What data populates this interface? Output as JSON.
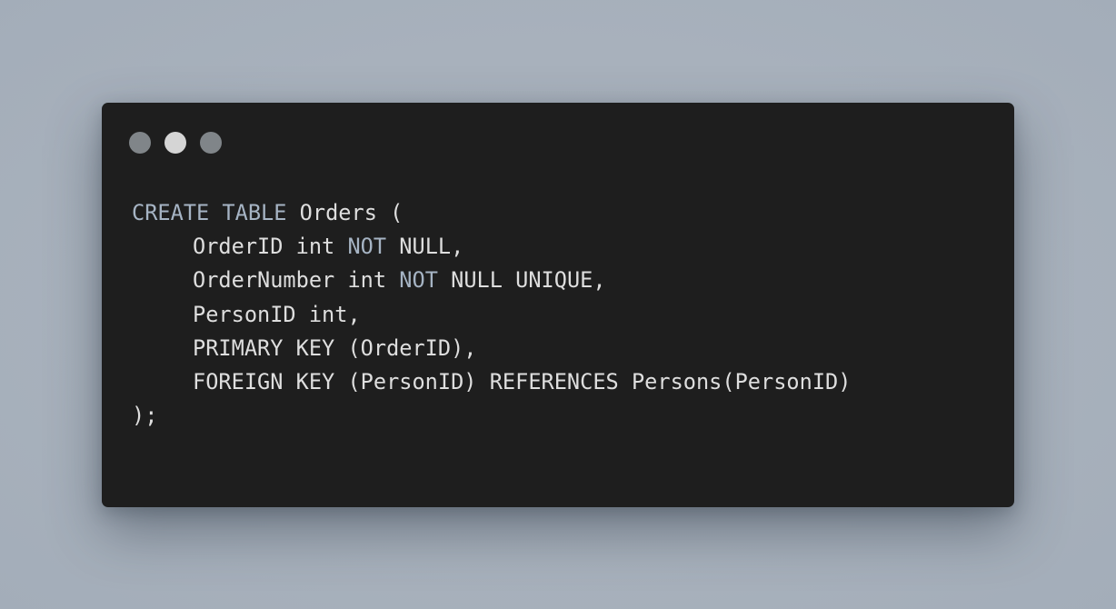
{
  "window": {
    "controls": [
      {
        "name": "close-dot",
        "color": "#808589"
      },
      {
        "name": "minimize-dot",
        "color": "#d5d5d5"
      },
      {
        "name": "maximize-dot",
        "color": "#808589"
      }
    ],
    "colors": {
      "background": "#1e1e1e",
      "text": "#dedede",
      "keyword": "#a6b4c4"
    }
  },
  "code": {
    "lines": [
      {
        "kw": "CREATE TABLE",
        "text": " Orders ("
      },
      {
        "text": "OrderID int ",
        "kw": "NOT",
        "tail": " NULL,"
      },
      {
        "text": "OrderNumber int ",
        "kw": "NOT",
        "tail": " NULL UNIQUE,"
      },
      {
        "text": "PersonID int,"
      },
      {
        "text": "PRIMARY KEY (OrderID),"
      },
      {
        "text": "FOREIGN KEY (PersonID) REFERENCES Persons(PersonID)"
      },
      {
        "text": ");"
      }
    ]
  }
}
